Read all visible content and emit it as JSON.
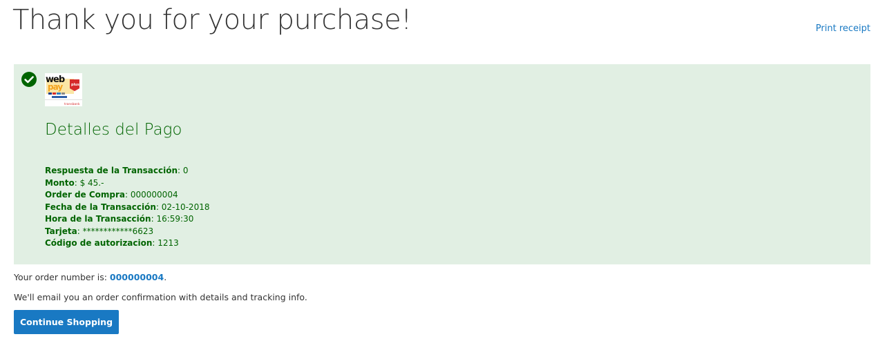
{
  "header": {
    "title": "Thank you for your purchase!",
    "print_receipt_label": "Print receipt"
  },
  "success": {
    "icon": "check-circle-icon",
    "logo": {
      "text_top": "web",
      "text_bottom": "pay",
      "badge": "plus",
      "footer": "transbank"
    },
    "details_title": "Detalles del Pago",
    "details": [
      {
        "label": "Respuesta de la Transacción",
        "value": "0"
      },
      {
        "label": "Monto",
        "value": "$ 45.-"
      },
      {
        "label": "Order de Compra",
        "value": "000000004"
      },
      {
        "label": "Fecha de la Transacción",
        "value": "02-10-2018"
      },
      {
        "label": "Hora de la Transacción",
        "value": "16:59:30"
      },
      {
        "label": "Tarjeta",
        "value": "************6623"
      },
      {
        "label": "Código de autorizacion",
        "value": "1213"
      }
    ]
  },
  "order": {
    "prefix": "Your order number is: ",
    "number": "000000004",
    "suffix": "."
  },
  "email_notice": "We'll email you an order confirmation with details and tracking info.",
  "continue_label": "Continue Shopping",
  "colors": {
    "success_bg": "#e1efe3",
    "success_text": "#006400",
    "link": "#1979c3",
    "button": "#1979c3"
  }
}
